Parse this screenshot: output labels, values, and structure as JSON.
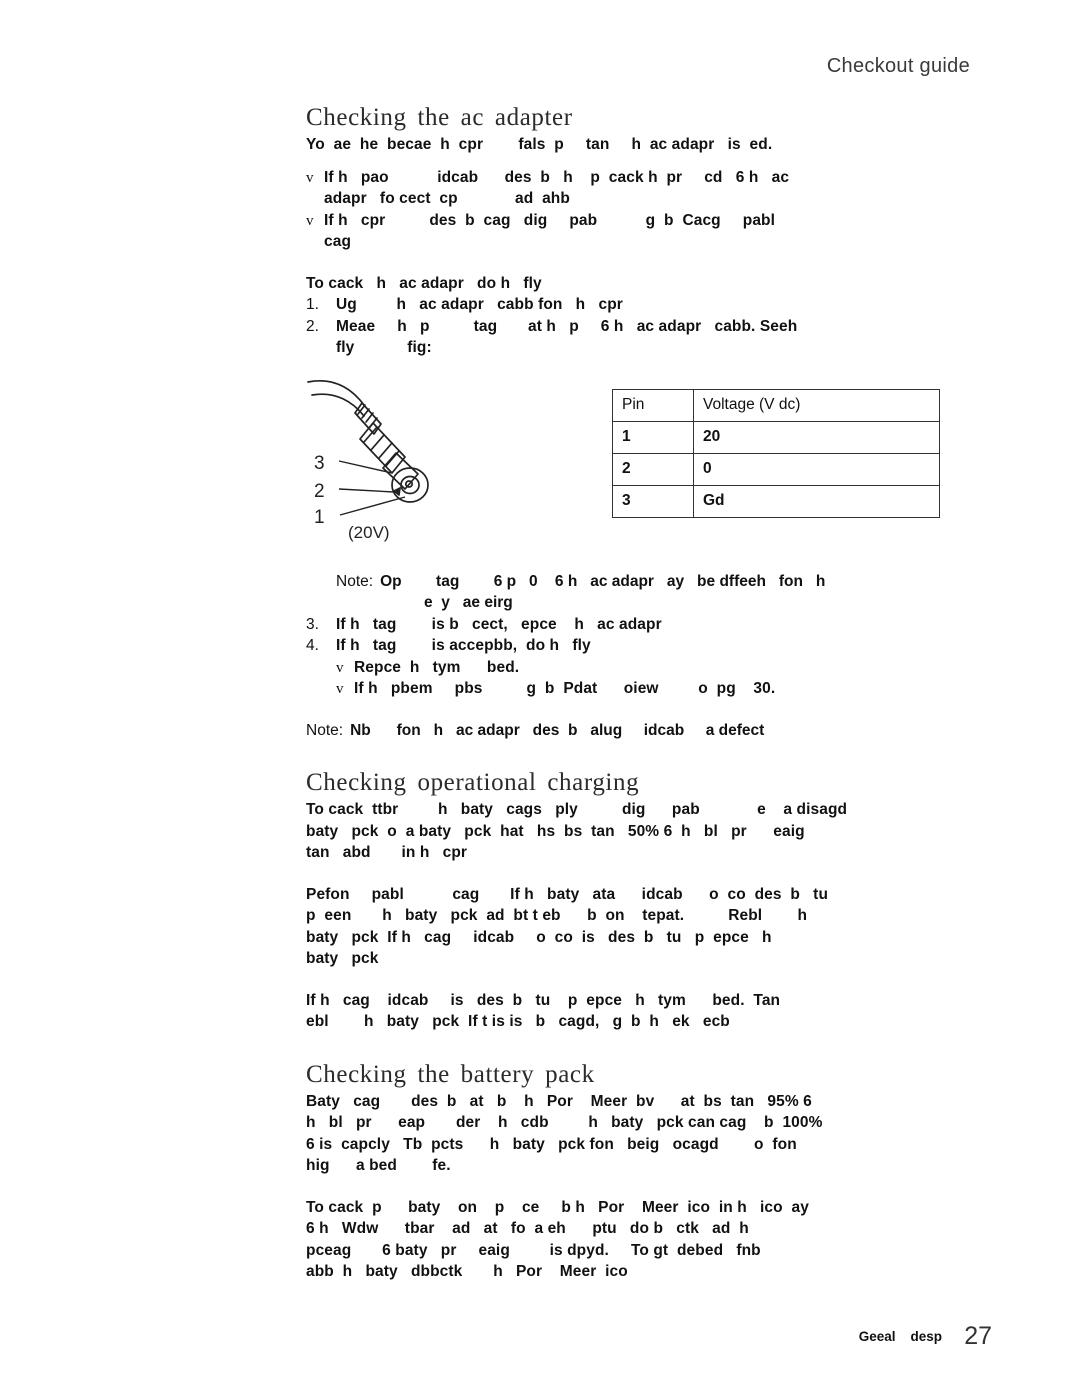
{
  "header": {
    "running_title": "Checkout guide"
  },
  "sections": {
    "ac_adapter": {
      "heading": "Checking  the ac adapter",
      "intro": "Yo  ae  he  becae  h  cpr        fals  p     tan     h  ac adapr   is  ed.",
      "bullets": [
        {
          "marker": "v",
          "line1": "If h   pao           idcab      des  b   h    p  cack h  pr     cd   6 h   ac",
          "line2": "adapr   fo cect  cp             ad  ahb"
        },
        {
          "marker": "v",
          "line1": "If h   cpr          des  b  cag   dig     pab           g  b  Cacg     pabl",
          "line2": "cag"
        }
      ],
      "procedure_lead": "To cack   h   ac adapr   do h   fly",
      "steps": [
        {
          "num": "1.",
          "line1": "Ug         h   ac adapr   cabb fon   h   cpr",
          "line2": ""
        },
        {
          "num": "2.",
          "line1": "Meae     h   p          tag       at h   p     6 h   ac adapr   cabb. Seeh",
          "line2": "fly            fig:"
        }
      ],
      "figure": {
        "caption": "(20V)",
        "pin_labels": [
          "3",
          "2",
          "1"
        ]
      },
      "table": {
        "columns": [
          "Pin",
          "Voltage  (V  dc)"
        ],
        "rows": [
          [
            "1",
            "20"
          ],
          [
            "2",
            "0"
          ],
          [
            "3",
            "Gd"
          ]
        ]
      },
      "note_mid": {
        "label": "Note:",
        "line1": "Op        tag        6 p   0    6 h   ac adapr   ay   be dffeeh   fon   h",
        "line2": "e  y   ae eirg"
      },
      "steps_after": [
        {
          "num": "3.",
          "line1": "If h   tag        is b   cect,   epce    h   ac adapr"
        },
        {
          "num": "4.",
          "line1": "If h   tag        is accepbb,  do h   fly"
        }
      ],
      "sub_bullets": [
        {
          "marker": "v",
          "line1": "Repce  h   tym      bed."
        },
        {
          "marker": "v",
          "line1": "If h   pbem     pbs          g  b  Pdat      oiew         o  pg    30."
        }
      ],
      "note_end": {
        "label": "Note:",
        "line1": "Nb      fon   h   ac adapr   des  b   alug     idcab     a defect"
      }
    },
    "operational_charging": {
      "heading": "Checking  operational  charging",
      "para1": [
        "To cack  ttbr         h   baty   cags   ply          dig      pab             e    a disagd",
        "baty   pck  o  a baty   pck  hat   hs  bs  tan   50% 6  h   bl   pr      eaig",
        "tan   abd       in h   cpr"
      ],
      "para2": [
        "Pefon     pabl           cag       If h   baty   ata      idcab      o  co  des  b   tu",
        "p  een       h   baty   pck  ad  bt t eb      b  on    tepat.          Rebl        h",
        "baty   pck  If h   cag     idcab     o  co  is   des  b   tu   p  epce   h",
        "baty   pck"
      ],
      "para3": [
        "If h   cag    idcab     is   des  b   tu    p  epce   h   tym      bed.  Tan",
        "ebl        h   baty   pck  If t is is   b   cagd,   g  b  h   ek   ecb"
      ]
    },
    "battery_pack": {
      "heading": "Checking  the battery pack",
      "para1": [
        "Baty   cag       des  b   at   b    h   Por    Meer  bv      at  bs  tan   95% 6",
        "h   bl   pr      eap       der    h   cdb         h   baty   pck can cag    b  100%",
        "6 is  capcly   Tb  pcts      h   baty   pck fon   beig   ocagd        o  fon",
        "hig      a bed        fe."
      ],
      "para2": [
        "To cack  p      baty    on    p    ce     b h   Por    Meer  ico  in h   ico  ay",
        "6 h   Wdw      tbar    ad   at   fo  a eh      ptu   do b   ctk   ad  h",
        "pceag       6 baty   pr     eaig         is dpyd.     To gt  debed   fnb",
        "abb  h   baty   dbbctk       h   Por    Meer  ico"
      ]
    }
  },
  "footer": {
    "label": "Geeal    desp",
    "page_number": "27"
  }
}
